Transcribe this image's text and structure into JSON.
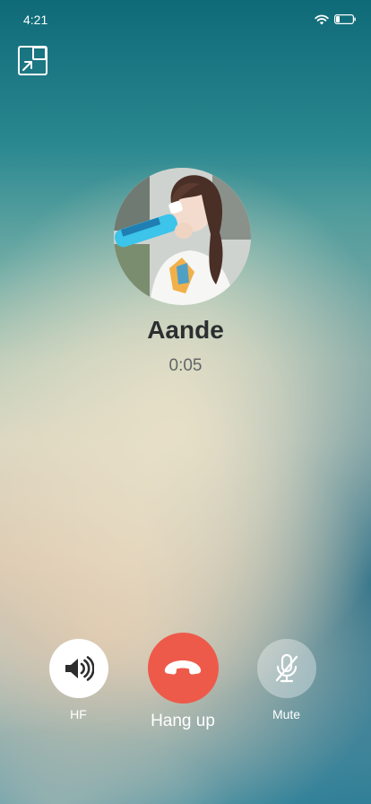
{
  "status_bar": {
    "time": "4:21",
    "wifi_icon": "wifi-icon",
    "battery_icon": "battery-icon"
  },
  "header": {
    "minimize_icon": "picture-in-picture-icon"
  },
  "contact": {
    "name": "Aande",
    "duration": "0:05",
    "avatar_icon": "avatar"
  },
  "controls": {
    "hands_free": {
      "label": "HF",
      "icon": "speaker-icon"
    },
    "hang_up": {
      "label": "Hang up",
      "icon": "phone-hangup-icon",
      "color": "#ee5a4a"
    },
    "mute": {
      "label": "Mute",
      "icon": "mic-off-icon"
    }
  }
}
